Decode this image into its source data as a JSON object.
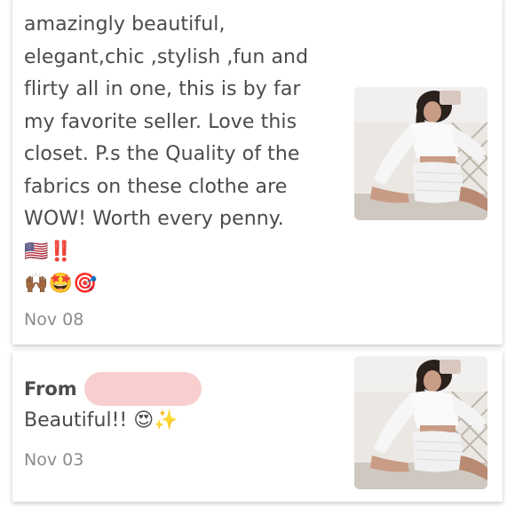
{
  "review_1": {
    "text": "amazingly beautiful, elegant,chic ,stylish ,fun and flirty all in one, this is by far my favorite seller. Love this closet. P.s the Quality of the fabrics on these clothe are WOW! Worth every penny.🇺🇸‼️",
    "emojis": "🙌🏾🤩🎯",
    "date": "Nov 08"
  },
  "review_2": {
    "from_label": "From",
    "message": "Beautiful!! 😍✨",
    "date": "Nov 03"
  },
  "colors": {
    "text": "#4b4b4b",
    "date": "#8c8c8c",
    "redaction": "#f7c9c9"
  }
}
